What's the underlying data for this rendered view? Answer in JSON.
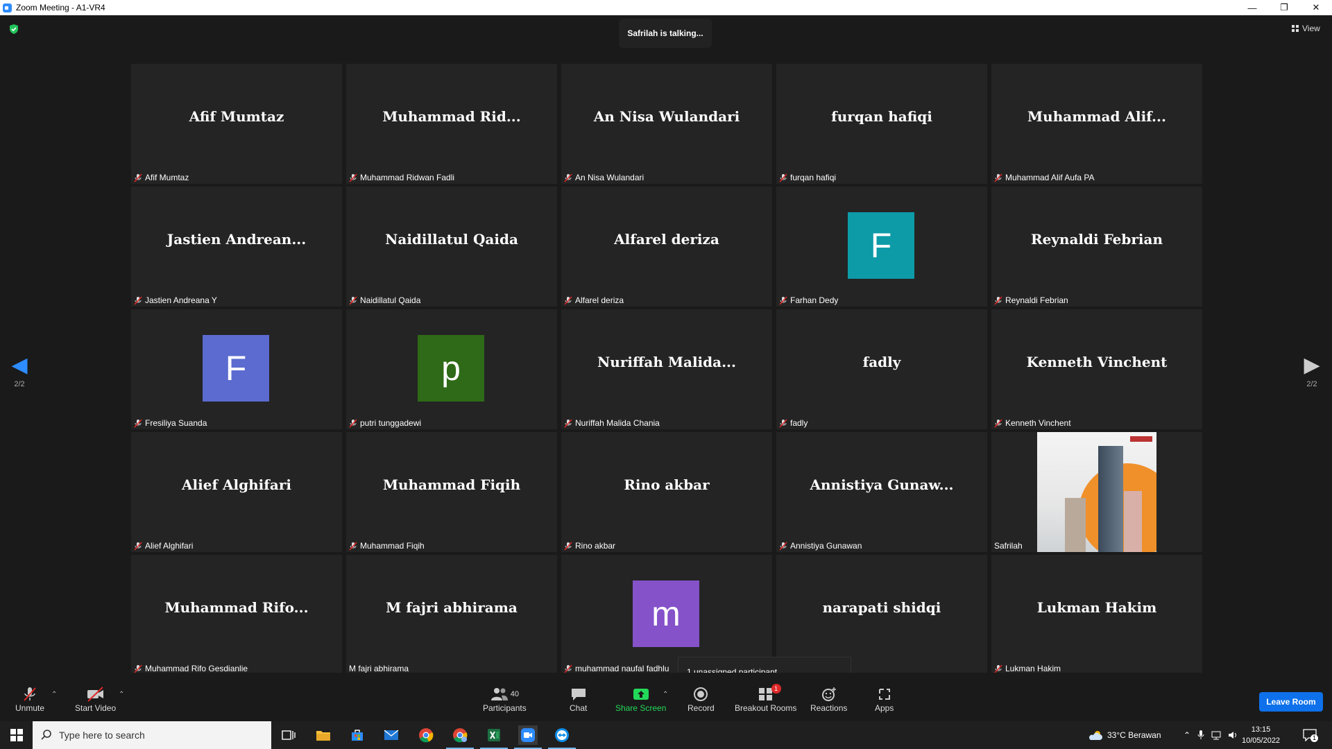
{
  "window": {
    "title": "Zoom Meeting - A1-VR4",
    "minimize_icon": "minimize-icon",
    "restore_icon": "restore-icon",
    "close_icon": "close-icon"
  },
  "meeting": {
    "talking_indicator": "Safrilah is talking...",
    "view_label": "View",
    "page_left": "2/2",
    "page_right": "2/2",
    "tooltip": "1 unassigned participant"
  },
  "participants": [
    {
      "big": "Afif Mumtaz",
      "label": "Afif Mumtaz",
      "muted": true
    },
    {
      "big": "Muhammad  Rid...",
      "label": "Muhammad Ridwan Fadli",
      "muted": true
    },
    {
      "big": "An Nisa Wulandari",
      "label": "An Nisa Wulandari",
      "muted": true
    },
    {
      "big": "furqan hafiqi",
      "label": "furqan hafiqi",
      "muted": true
    },
    {
      "big": "Muhammad  Alif...",
      "label": "Muhammad Alif Aufa PA",
      "muted": true
    },
    {
      "big": "Jastien  Andrean...",
      "label": "Jastien Andreana Y",
      "muted": true
    },
    {
      "big": "Naidillatul Qaida",
      "label": "Naidillatul Qaida",
      "muted": true
    },
    {
      "big": "Alfarel deriza",
      "label": "Alfarel deriza",
      "muted": true
    },
    {
      "avatar": "F",
      "avatar_color": "#0E9BA8",
      "label": "Farhan Dedy",
      "muted": true
    },
    {
      "big": "Reynaldi Febrian",
      "label": "Reynaldi Febrian",
      "muted": true
    },
    {
      "avatar": "F",
      "avatar_color": "#5B6BCF",
      "label": "Fresiliya Suanda",
      "muted": true
    },
    {
      "avatar": "p",
      "avatar_color": "#2E6A17",
      "label": "putri tunggadewi",
      "muted": true
    },
    {
      "big": "Nuriffah  Malida...",
      "label": "Nuriffah Malida Chania",
      "muted": true
    },
    {
      "big": "fadly",
      "label": "fadly",
      "muted": true
    },
    {
      "big": "Kenneth Vinchent",
      "label": "Kenneth Vinchent",
      "muted": true
    },
    {
      "big": "Alief Alghifari",
      "label": "Alief Alghifari",
      "muted": true
    },
    {
      "big": "Muhammad Fiqih",
      "label": "Muhammad Fiqih",
      "muted": true
    },
    {
      "big": "Rino akbar",
      "label": "Rino akbar",
      "muted": true
    },
    {
      "big": "Annistiya  Gunaw...",
      "label": "Annistiya Gunawan",
      "muted": true
    },
    {
      "video": true,
      "label": "Safrilah",
      "muted": false
    },
    {
      "big": "Muhammad  Rifo...",
      "label": "Muhammad Rifo Gesdianlie",
      "muted": true
    },
    {
      "big": "M fajri abhirama",
      "label": "M fajri abhirama",
      "muted": false
    },
    {
      "avatar": "m",
      "avatar_color": "#8552C9",
      "label": "muhammad naufal fadhlu",
      "muted": true
    },
    {
      "big": "narapati shidqi",
      "label": "",
      "muted": false
    },
    {
      "big": "Lukman Hakim",
      "label": "Lukman Hakim",
      "muted": true
    }
  ],
  "toolbar": {
    "unmute": "Unmute",
    "start_video": "Start Video",
    "participants": "Participants",
    "participants_count": "40",
    "chat": "Chat",
    "share_screen": "Share Screen",
    "record": "Record",
    "breakout_rooms": "Breakout Rooms",
    "breakout_badge": "1",
    "reactions": "Reactions",
    "apps": "Apps",
    "leave_room": "Leave Room",
    "share_color": "#23D959"
  },
  "taskbar": {
    "search_placeholder": "Type here to search",
    "weather": "33°C  Berawan",
    "time": "13:15",
    "date": "10/05/2022",
    "notification_count": "1"
  }
}
